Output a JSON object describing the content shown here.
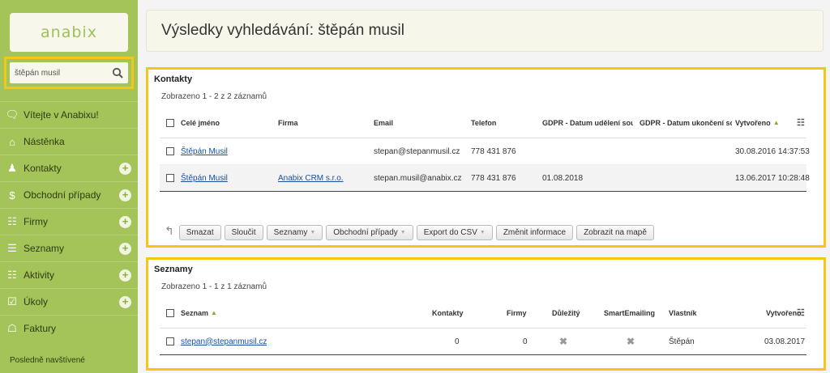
{
  "brand": {
    "logo_text": "anabix",
    "accent": "#a4c45a",
    "highlight": "#f5c518"
  },
  "search": {
    "value": "štěpán musil"
  },
  "nav": {
    "items": [
      {
        "label": "Vítejte v Anabixu!",
        "icon": "chat-icon",
        "plus": false
      },
      {
        "label": "Nástěnka",
        "icon": "home-icon",
        "plus": false
      },
      {
        "label": "Kontakty",
        "icon": "person-icon",
        "plus": true
      },
      {
        "label": "Obchodní případy",
        "icon": "dollar-icon",
        "plus": true
      },
      {
        "label": "Firmy",
        "icon": "group-icon",
        "plus": true
      },
      {
        "label": "Seznamy",
        "icon": "list-icon",
        "plus": true
      },
      {
        "label": "Aktivity",
        "icon": "clipboard-icon",
        "plus": true
      },
      {
        "label": "Úkoly",
        "icon": "task-icon",
        "plus": true
      },
      {
        "label": "Faktury",
        "icon": "invoice-icon",
        "plus": false
      }
    ],
    "recent_label": "Posledně navštívené"
  },
  "header": {
    "title": "Výsledky vyhledávání: štěpán musil"
  },
  "contacts": {
    "title": "Kontakty",
    "count": "Zobrazeno 1 - 2 z 2 záznamů",
    "columns": [
      "Celé jméno",
      "Firma",
      "Email",
      "Telefon",
      "GDPR - Datum udělení souhlasu",
      "GDPR - Datum ukončení souhlasu",
      "Vytvořeno"
    ],
    "rows": [
      {
        "name": "Štěpán Musil",
        "company": "",
        "email": "stepan@stepanmusil.cz",
        "phone": "778 431 876",
        "gdpr_start": "",
        "gdpr_end": "",
        "created": "30.08.2016 14:37:53"
      },
      {
        "name": "Štěpán Musil",
        "company": "Anabix CRM s.r.o.",
        "email": "stepan.musil@anabix.cz",
        "phone": "778 431 876",
        "gdpr_start": "01.08.2018",
        "gdpr_end": "",
        "created": "13.06.2017 10:28:48"
      }
    ],
    "actions": [
      "Smazat",
      "Sloučit",
      "Seznamy",
      "Obchodní případy",
      "Export do CSV",
      "Změnit informace",
      "Zobrazit na mapě"
    ]
  },
  "lists": {
    "title": "Seznamy",
    "count": "Zobrazeno 1 - 1 z 1 záznamů",
    "columns": [
      "Seznam",
      "Kontakty",
      "Firmy",
      "Důležitý",
      "SmartEmailing",
      "Vlastník",
      "Vytvořeno"
    ],
    "rows": [
      {
        "name": "stepan@stepanmusil.cz",
        "contacts": "0",
        "companies": "0",
        "owner": "Štěpán",
        "created": "03.08.2017"
      }
    ]
  }
}
